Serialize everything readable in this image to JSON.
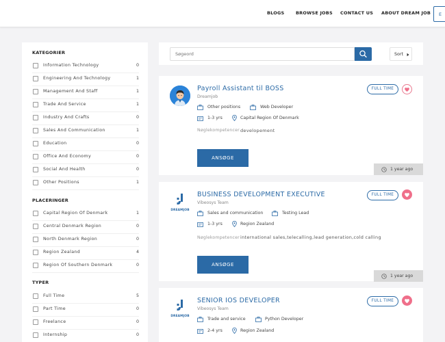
{
  "nav": {
    "links": [
      "BLOGS",
      "BROWSE JOBS",
      "CONTACT US",
      "ABOUT DREAM JOB"
    ],
    "lang_button": "E"
  },
  "sidebar": {
    "kategorier_title": "KATEGORIER",
    "kategorier": [
      {
        "label": "Information Technology",
        "count": "0"
      },
      {
        "label": "Engineering And Technology",
        "count": "1"
      },
      {
        "label": "Management And Staff",
        "count": "1"
      },
      {
        "label": "Trade And Service",
        "count": "1"
      },
      {
        "label": "Industry And Crafts",
        "count": "0"
      },
      {
        "label": "Sales And Communication",
        "count": "1"
      },
      {
        "label": "Education",
        "count": "0"
      },
      {
        "label": "Office And Economy",
        "count": "0"
      },
      {
        "label": "Social And Health",
        "count": "0"
      },
      {
        "label": "Other Positions",
        "count": "1"
      }
    ],
    "placeringer_title": "PLACERINGER",
    "placeringer": [
      {
        "label": "Capital Region Of Denmark",
        "count": "1"
      },
      {
        "label": "Central Denmark Region",
        "count": "0"
      },
      {
        "label": "North Denmark Region",
        "count": "0"
      },
      {
        "label": "Region Zealand",
        "count": "4"
      },
      {
        "label": "Region Of Southern Denmark",
        "count": "0"
      }
    ],
    "typer_title": "TYPER",
    "typer": [
      {
        "label": "Full Time",
        "count": "5"
      },
      {
        "label": "Part Time",
        "count": "0"
      },
      {
        "label": "Freelance",
        "count": "0"
      },
      {
        "label": "Internship",
        "count": "0"
      }
    ]
  },
  "search": {
    "placeholder": "Søgeord",
    "sort_label": "Sort"
  },
  "jobs": [
    {
      "title": "Payroll Assistant til BOSS",
      "company": "Dreamjob",
      "category": "Other positions",
      "role": "Web Developer",
      "experience": "1-3 yrs",
      "location": "Capital Region Of Denmark",
      "skills_label": "Nøglekompetencer",
      "skills": "developement",
      "apply_label": "ANSØGE",
      "type": "FULL TIME",
      "posted": "1 year ago"
    },
    {
      "title": "BUSINESS DEVELOPMENT EXECUTIVE",
      "company": "Vibeosys Team",
      "category": "Sales and communication",
      "role": "Testing Lead",
      "experience": "1-3 yrs",
      "location": "Region Zealand",
      "skills_label": "Nøglekompetencer",
      "skills": "international sales,telecalling,lead generation,cold calling",
      "apply_label": "ANSØGE",
      "type": "FULL TIME",
      "posted": "1 year ago"
    },
    {
      "title": "SENIOR IOS DEVELOPER",
      "company": "Vibeosys Team",
      "category": "Trade and service",
      "role": "Python Developer",
      "experience": "2-4 yrs",
      "location": "Region Zealand",
      "type": "FULL TIME"
    }
  ],
  "logo_text": "DREAMJOB",
  "colors": {
    "accent": "#2b6aa6",
    "heart": "#ef6f8a"
  }
}
